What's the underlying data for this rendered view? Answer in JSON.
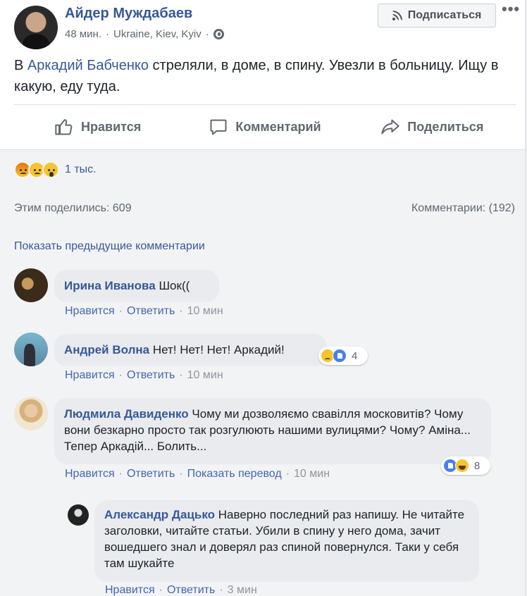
{
  "post": {
    "author": "Айдер Муждабаев",
    "time": "48 мин.",
    "location": "Ukraine, Kiev, Kyiv",
    "subscribe_label": "Подписаться",
    "more": "•••",
    "text_prefix": "В ",
    "text_link": "Аркадий Бабченко",
    "text_rest": " стреляли, в доме, в спину. Увезли в больницу. Ищу в какую, еду туда."
  },
  "actions": {
    "like": "Нравится",
    "comment": "Комментарий",
    "share": "Поделиться"
  },
  "stats": {
    "reactions_count": "1 тыс.",
    "reaction_icons": [
      "angry-icon",
      "sad-icon",
      "wow-icon"
    ],
    "shares": "Этим поделились: 609",
    "comments": "Комментарии: (192)",
    "show_previous": "Показать предыдущие комментарии"
  },
  "comments": [
    {
      "name": "Ирина Иванова",
      "text": "Шок((",
      "like": "Нравится",
      "reply": "Ответить",
      "time": "10 мин"
    },
    {
      "name": "Андрей Волна",
      "text": "Нет! Нет! Нет! Аркадий!",
      "like": "Нравится",
      "reply": "Ответить",
      "time": "10 мин",
      "reaction_count": "4",
      "reaction_icons": [
        "sad-icon",
        "like-icon"
      ]
    },
    {
      "name": "Людмила Давиденко",
      "text": "Чому ми дозволяємо свавілля московитів? Чому вони безкарно просто так розгулюють нашими вулицями? Чому? Аміна... Тепер Аркадій... Болить...",
      "like": "Нравится",
      "reply": "Ответить",
      "translate": "Показать перевод",
      "time": "10 мин",
      "reaction_count": "8",
      "reaction_icons": [
        "like-icon",
        "haha-icon"
      ]
    },
    {
      "name": "Александр Дацько",
      "text": "Наверно последний раз напишу. Не читайте заголовки, читайте статьи. Убили в спину у него дома, зачит вошедшего знал и доверял раз спиной повернулся. Таки у себя там шукайте",
      "like": "Нравится",
      "reply": "Ответить",
      "time": "3 мин"
    }
  ],
  "colors": {
    "link": "#365899",
    "meta": "#90949c",
    "bubble": "#e9ebee",
    "band": "#f2f3f5"
  },
  "separator": "·"
}
